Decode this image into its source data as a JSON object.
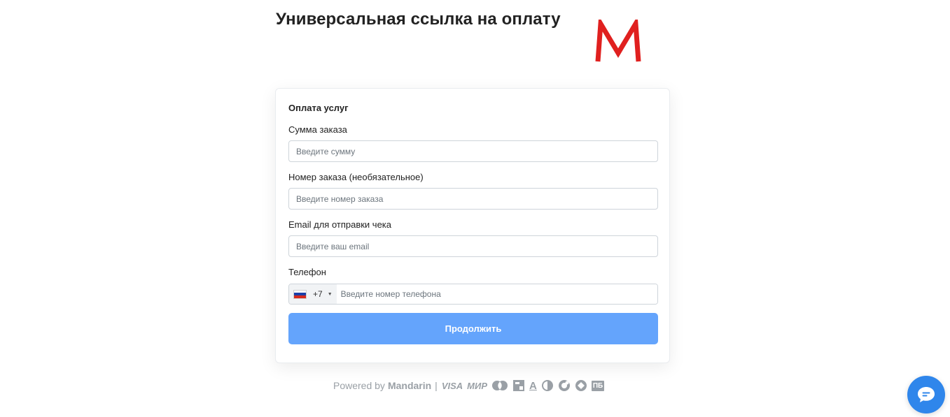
{
  "header": {
    "title": "Универсальная ссылка на оплату",
    "logo_letter": "M",
    "logo_color": "#e0201f"
  },
  "form": {
    "title": "Оплата услуг",
    "fields": [
      {
        "label": "Сумма заказа",
        "placeholder": "Введите сумму"
      },
      {
        "label": "Номер заказа (необязательное)",
        "placeholder": "Введите номер заказа"
      },
      {
        "label": "Email для отправки чека",
        "placeholder": "Введите ваш email"
      }
    ],
    "phone": {
      "label": "Телефон",
      "country_flag": "russia-flag-icon",
      "dial_code": "+7",
      "placeholder": "Введите номер телефона"
    },
    "submit_label": "Продолжить",
    "submit_color": "#64a4fc"
  },
  "footer": {
    "powered_by": "Powered by",
    "brand": "Mandarin",
    "separator": "|",
    "payment_logos": [
      {
        "name": "visa-logo",
        "text": "VISA"
      },
      {
        "name": "mir-logo",
        "text": "МИР"
      },
      {
        "name": "mastercard-logo"
      },
      {
        "name": "mts-logo"
      },
      {
        "name": "alfa-bank-logo",
        "text": "А"
      },
      {
        "name": "payment-circle-logo-1"
      },
      {
        "name": "payment-circle-logo-2"
      },
      {
        "name": "payment-circle-logo-3"
      },
      {
        "name": "pb-logo",
        "text": "ПБ"
      }
    ]
  },
  "chat": {
    "icon": "chat-bubble-icon",
    "color": "#2f86eb"
  }
}
